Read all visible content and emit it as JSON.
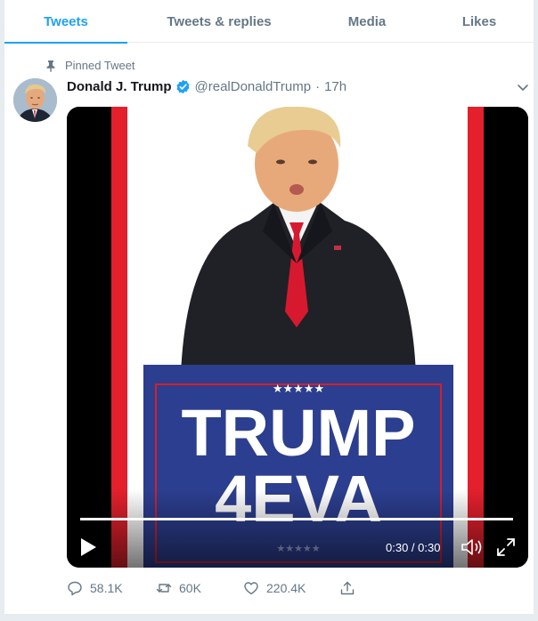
{
  "tabs": [
    {
      "label": "Tweets",
      "active": true
    },
    {
      "label": "Tweets & replies",
      "active": false
    },
    {
      "label": "Media",
      "active": false
    },
    {
      "label": "Likes",
      "active": false
    }
  ],
  "tweet": {
    "pinned_label": "Pinned Tweet",
    "author_name": "Donald J. Trump",
    "handle": "@realDonaldTrump",
    "separator": "·",
    "time": "17h",
    "verified": true
  },
  "video": {
    "sign_line1": "TRUMP",
    "sign_line2": "4EVA",
    "stars": "★★★★★",
    "time_display": "0:30 / 0:30",
    "progress": 1.0
  },
  "actions": {
    "replies": "58.1K",
    "retweets": "60K",
    "likes": "220.4K"
  },
  "colors": {
    "accent": "#1da1f2",
    "muted": "#657786",
    "sign_blue": "#2c3e8f",
    "sign_red": "#d4202a"
  },
  "icons": [
    "pin-icon",
    "verified-badge-icon",
    "chevron-down-icon",
    "play-icon",
    "volume-icon",
    "fullscreen-icon",
    "reply-icon",
    "retweet-icon",
    "like-icon",
    "share-icon"
  ]
}
